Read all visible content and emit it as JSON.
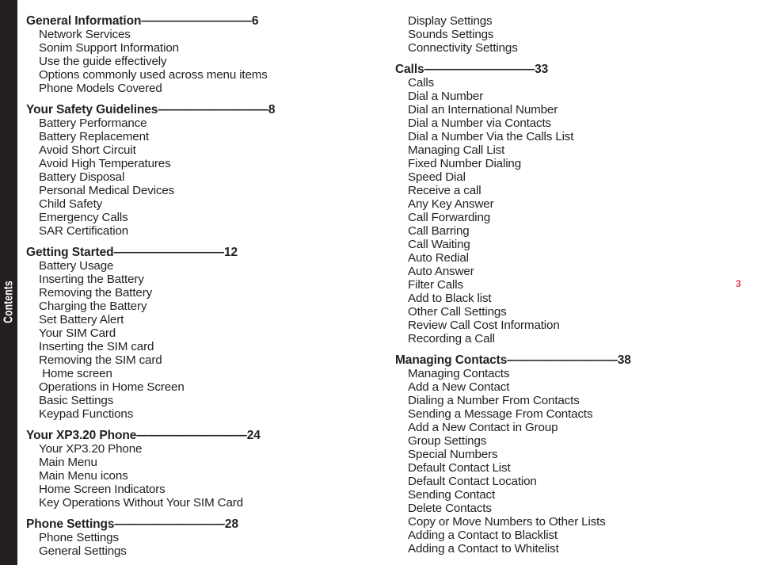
{
  "side_tab": {
    "label": "Contents"
  },
  "page_number": "3",
  "colors": {
    "tab_background": "#231f20",
    "text": "#231f20",
    "page_number": "#e8334a",
    "background": "#ffffff"
  },
  "leader": "————————",
  "columns": {
    "left": [
      {
        "heading": "General Information",
        "leader": "—————————",
        "page": "6",
        "items": [
          "Network Services",
          "Sonim Support Information",
          "Use the guide effectively",
          "Options commonly used across menu items",
          "Phone Models Covered"
        ]
      },
      {
        "heading": "Your Safety Guidelines",
        "leader": "—————————",
        "page": "8",
        "items": [
          "Battery Performance",
          "Battery Replacement",
          "Avoid Short Circuit",
          "Avoid High Temperatures",
          "Battery Disposal",
          "Personal Medical Devices",
          "Child Safety",
          "Emergency Calls",
          "SAR Certification"
        ]
      },
      {
        "heading": "Getting Started",
        "leader": "—————————",
        "page": "12",
        "items": [
          "Battery Usage",
          "Inserting the Battery",
          "Removing the Battery",
          "Charging the Battery",
          "Set Battery Alert",
          "Your SIM Card",
          "Inserting the SIM card",
          "Removing the SIM card",
          " Home screen",
          "Operations in Home Screen",
          "Basic Settings",
          "Keypad Functions"
        ]
      },
      {
        "heading": "Your XP3.20 Phone",
        "leader": "—————————",
        "page": "24",
        "items": [
          "Your XP3.20 Phone",
          "Main Menu",
          "Main Menu icons",
          "Home Screen Indicators",
          "Key Operations Without Your SIM Card"
        ]
      },
      {
        "heading": "Phone Settings",
        "leader": "—————————",
        "page": "28",
        "items": [
          "Phone Settings",
          "General Settings"
        ]
      }
    ],
    "right": [
      {
        "heading": "",
        "leader": "",
        "page": "",
        "items": [
          "Display Settings",
          "Sounds Settings",
          "Connectivity Settings"
        ]
      },
      {
        "heading": "Calls",
        "leader": "—————————",
        "page": "33",
        "items": [
          "Calls",
          "Dial a Number",
          "Dial an International Number",
          "Dial a Number via Contacts",
          "Dial a Number Via the Calls List",
          "Managing Call List",
          "Fixed Number Dialing",
          "Speed Dial",
          "Receive a call",
          "Any Key Answer",
          "Call Forwarding",
          "Call Barring",
          "Call Waiting",
          "Auto Redial",
          "Auto Answer",
          "Filter Calls",
          "Add to Black list",
          "Other Call Settings",
          "Review Call Cost Information",
          "Recording a Call"
        ]
      },
      {
        "heading": "Managing Contacts",
        "leader": "—————————",
        "page": "38",
        "items": [
          "Managing Contacts",
          "Add a New Contact",
          "Dialing a Number From Contacts",
          "Sending a Message From Contacts",
          "Add a New Contact in Group",
          "Group Settings",
          "Special Numbers",
          "Default Contact List",
          "Default Contact Location",
          "Sending Contact",
          "Delete Contacts",
          "Copy or Move Numbers to Other Lists",
          "Adding a Contact to Blacklist",
          "Adding a Contact to Whitelist"
        ]
      }
    ]
  }
}
